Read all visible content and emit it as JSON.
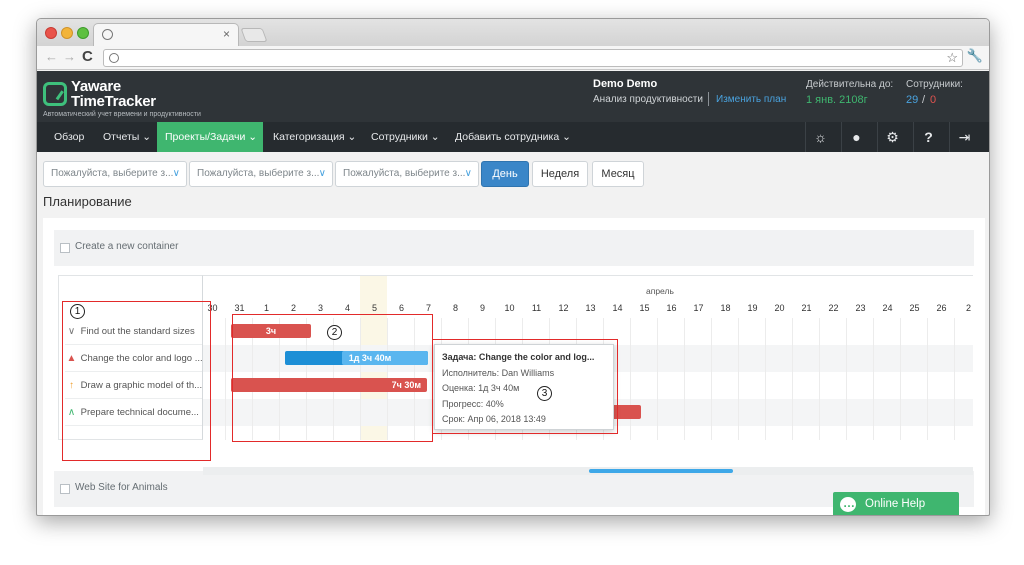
{
  "browser": {
    "tab_close": "×"
  },
  "header": {
    "logo_line1": "Yaware",
    "logo_line2": "TimeTracker",
    "logo_sub": "Автоматический учет времени и продуктивности",
    "user_name": "Demo Demo",
    "plan_name": "Анализ продуктивности",
    "change_plan": "Изменить план",
    "valid_label": "Действительна до:",
    "valid_value": "1 янв. 2108г",
    "staff_label": "Сотрудники:",
    "staff_used": "29",
    "staff_slash": "/",
    "staff_free": "0"
  },
  "menu": {
    "items": [
      {
        "label": "Обзор"
      },
      {
        "label": "Отчеты ⌄"
      },
      {
        "label": "Проекты/Задачи ⌄"
      },
      {
        "label": "Категоризация ⌄"
      },
      {
        "label": "Сотрудники ⌄"
      },
      {
        "label": "Добавить сотрудника ⌄"
      }
    ],
    "active_index": 2,
    "icons": [
      "lightbulb-icon",
      "user-icon",
      "gear-icon",
      "help-icon",
      "logout-icon"
    ]
  },
  "filters": {
    "items": [
      {
        "placeholder": "Пожалуйста, выберите з..."
      },
      {
        "placeholder": "Пожалуйста, выберите з..."
      },
      {
        "placeholder": "Пожалуйста, выберите з..."
      }
    ],
    "btn_day": "День",
    "btn_week": "Неделя",
    "btn_month": "Месяц"
  },
  "page_title": "Планирование",
  "containers": [
    {
      "label": "Create a new container"
    },
    {
      "label": "Web Site for Animals"
    }
  ],
  "gantt": {
    "month": "апрель",
    "days": [
      "30",
      "31",
      "1",
      "2",
      "3",
      "4",
      "5",
      "6",
      "7",
      "8",
      "9",
      "10",
      "11",
      "12",
      "13",
      "14",
      "15",
      "16",
      "17",
      "18",
      "19",
      "20",
      "21",
      "22",
      "23",
      "24",
      "25",
      "26",
      "2"
    ],
    "tasks": [
      {
        "name": "Find out the standard sizes",
        "icon": "chevron-down-icon",
        "glyph": "⌄",
        "color": "#777777"
      },
      {
        "name": "Change the color and logo ...",
        "icon": "arrow-up-red-icon",
        "glyph": "▲",
        "color": "#d9534f"
      },
      {
        "name": "Draw a graphic model of th...",
        "icon": "arrow-up-orange-icon",
        "glyph": "↑",
        "color": "#f0a030"
      },
      {
        "name": "Prepare technical docume...",
        "icon": "chevron-up-icon",
        "glyph": "⌃",
        "color": "#3fb66f"
      }
    ],
    "bars": [
      {
        "label": "3ч"
      },
      {
        "label": "1д 3ч 40м"
      },
      {
        "label": "7ч 30м"
      },
      {
        "label": ""
      }
    ]
  },
  "tooltip": {
    "title": "Задача: Change the color and log...",
    "assignee": "Исполнитель: Dan Williams",
    "estimate": "Оценка: 1д 3ч 40м",
    "progress": "Прогресс: 40%",
    "deadline": "Срок: Апр 06, 2018 13:49"
  },
  "annotations": [
    "1",
    "2",
    "3"
  ],
  "help": {
    "label": "Online Help"
  }
}
